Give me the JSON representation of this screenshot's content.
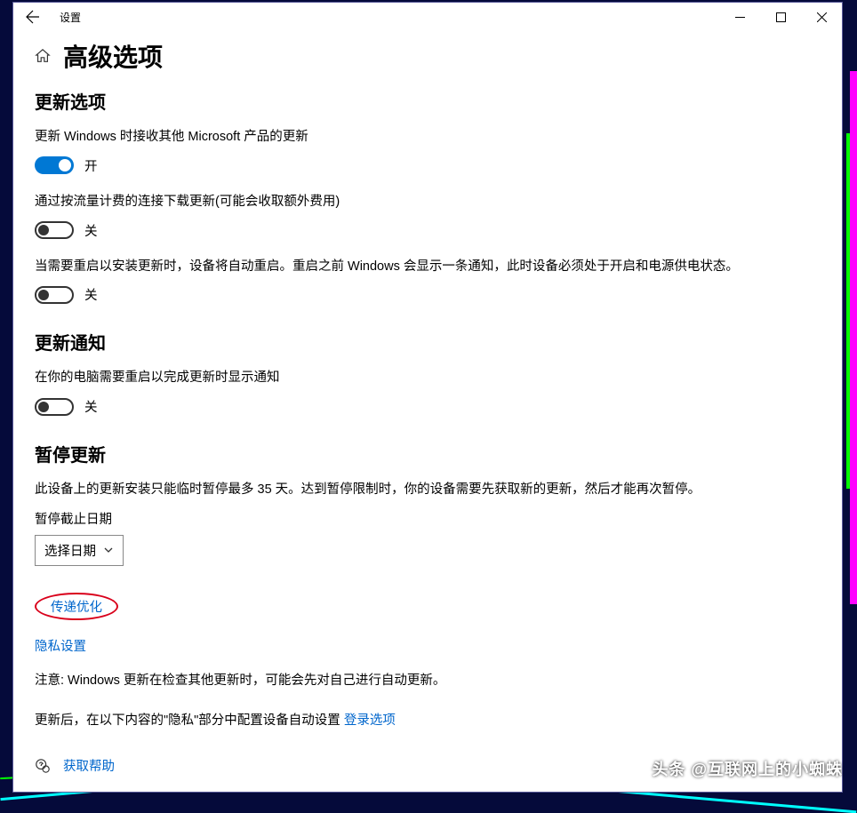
{
  "window": {
    "title": "设置"
  },
  "page": {
    "title": "高级选项"
  },
  "sections": {
    "updateOptions": {
      "heading": "更新选项",
      "opt1": {
        "text": "更新 Windows 时接收其他 Microsoft 产品的更新",
        "state": "开"
      },
      "opt2": {
        "text": "通过按流量计费的连接下载更新(可能会收取额外费用)",
        "state": "关"
      },
      "opt3": {
        "text": "当需要重启以安装更新时，设备将自动重启。重启之前 Windows 会显示一条通知，此时设备必须处于开启和电源供电状态。",
        "state": "关"
      }
    },
    "updateNotify": {
      "heading": "更新通知",
      "opt1": {
        "text": "在你的电脑需要重启以完成更新时显示通知",
        "state": "关"
      }
    },
    "pauseUpdate": {
      "heading": "暂停更新",
      "desc": "此设备上的更新安装只能临时暂停最多 35 天。达到暂停限制时，你的设备需要先获取新的更新，然后才能再次暂停。",
      "dateLabel": "暂停截止日期",
      "dropdown": "选择日期"
    }
  },
  "links": {
    "delivery": "传递优化",
    "privacy": "隐私设置",
    "login": "登录选项",
    "help": "获取帮助"
  },
  "notes": {
    "n1": "注意: Windows 更新在检查其他更新时，可能会先对自己进行自动更新。",
    "n2a": "更新后，在以下内容的\"隐私\"部分中配置设备自动设置 "
  },
  "watermark": "头条 @互联网上的小蜘蛛"
}
